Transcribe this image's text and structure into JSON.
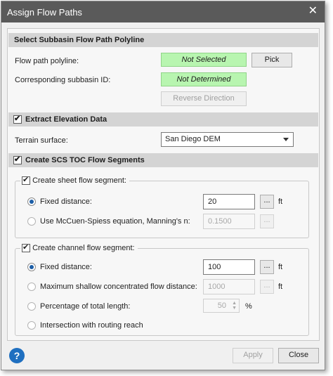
{
  "window": {
    "title": "Assign Flow Paths",
    "close_glyph": "✕"
  },
  "select_section": {
    "header": "Select Subbasin Flow Path Polyline",
    "flow_path_label": "Flow path polyline:",
    "flow_path_status": "Not Selected",
    "pick_label": "Pick",
    "subbasin_label": "Corresponding subbasin ID:",
    "subbasin_status": "Not Determined",
    "reverse_label": "Reverse Direction"
  },
  "elevation_section": {
    "header": "Extract Elevation Data",
    "checked": true,
    "terrain_label": "Terrain surface:",
    "terrain_value": "San Diego DEM"
  },
  "scs_section": {
    "header": "Create SCS TOC Flow Segments",
    "checked": true,
    "sheet": {
      "group_label": "Create sheet flow segment:",
      "checked": true,
      "fixed_label": "Fixed distance:",
      "fixed_value": "20",
      "fixed_unit": "ft",
      "mccuen_label": "Use McCuen-Spiess equation, Manning's n:",
      "mccuen_value": "0.1500",
      "browse": "..."
    },
    "channel": {
      "group_label": "Create channel flow segment:",
      "checked": true,
      "fixed_label": "Fixed distance:",
      "fixed_value": "100",
      "fixed_unit": "ft",
      "max_label": "Maximum shallow concentrated flow distance:",
      "max_value": "1000",
      "max_unit": "ft",
      "percent_label": "Percentage of total length:",
      "percent_value": "50",
      "percent_unit": "%",
      "intersection_label": "Intersection with routing reach",
      "browse": "..."
    }
  },
  "footer": {
    "help_glyph": "?",
    "apply_label": "Apply",
    "close_label": "Close"
  },
  "colors": {
    "title_bar": "#5a5a5a",
    "status_green": "#b8f5b0",
    "section_header": "#d4d4d4",
    "help_blue": "#1f6fc0"
  }
}
